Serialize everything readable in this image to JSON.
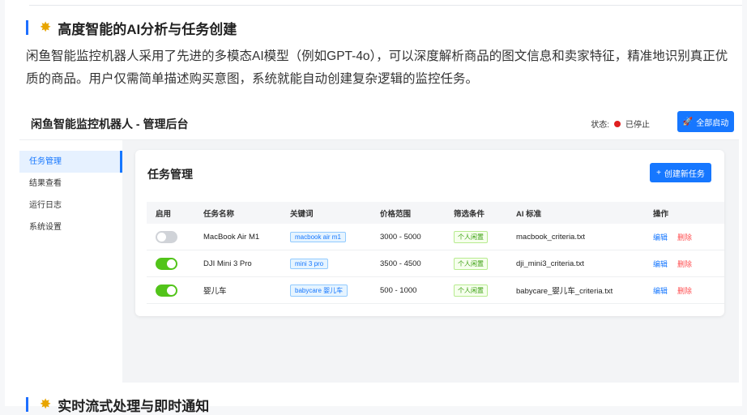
{
  "section": {
    "icon": "sparkle-icon",
    "title": "高度智能的AI分析与任务创建",
    "description": "闲鱼智能监控机器人采用了先进的多模态AI模型（例如GPT-4o），可以深度解析商品的图文信息和卖家特征，精准地识别真正优质的商品。用户仅需简单描述购买意图，系统就能自动创建复杂逻辑的监控任务。"
  },
  "app": {
    "title": "闲鱼智能监控机器人 - 管理后台",
    "status_label": "状态:",
    "status_value": "已停止",
    "status_color": "#e02020",
    "start_all_label": "全部启动",
    "sidebar": {
      "items": [
        {
          "label": "任务管理",
          "active": true
        },
        {
          "label": "结果查看",
          "active": false
        },
        {
          "label": "运行日志",
          "active": false
        },
        {
          "label": "系统设置",
          "active": false
        }
      ]
    },
    "card": {
      "title": "任务管理",
      "create_label": "创建新任务"
    },
    "table": {
      "columns": [
        "启用",
        "任务名称",
        "关键词",
        "价格范围",
        "筛选条件",
        "AI 标准",
        "操作"
      ],
      "rows": [
        {
          "enabled": false,
          "name": "MacBook Air M1",
          "keyword": "macbook air m1",
          "price": "3000 - 5000",
          "filter": "个人闲置",
          "criteria": "macbook_criteria.txt",
          "edit": "编辑",
          "delete": "删除"
        },
        {
          "enabled": true,
          "name": "DJI Mini 3 Pro",
          "keyword": "mini 3 pro",
          "price": "3500 - 4500",
          "filter": "个人闲置",
          "criteria": "dji_mini3_criteria.txt",
          "edit": "编辑",
          "delete": "删除"
        },
        {
          "enabled": true,
          "name": "婴儿车",
          "keyword": "babycare 婴儿车",
          "price": "500 - 1000",
          "filter": "个人闲置",
          "criteria": "babycare_婴儿车_criteria.txt",
          "edit": "编辑",
          "delete": "删除"
        }
      ]
    },
    "colors": {
      "accent": "#1677ff",
      "enabled": "#52c41a",
      "disabled": "#d0d3d8",
      "danger": "#ff4d4f"
    }
  },
  "next_section": {
    "icon": "sparkle-icon",
    "title": "实时流式处理与即时通知"
  }
}
